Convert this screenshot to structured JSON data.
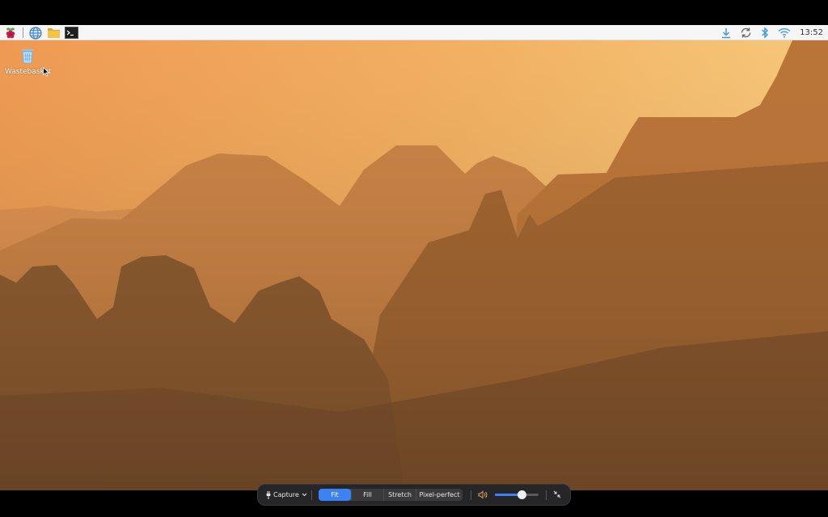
{
  "taskbar": {
    "launchers": [
      {
        "name": "raspberry-menu-icon"
      },
      {
        "name": "web-browser-icon"
      },
      {
        "name": "file-manager-icon"
      },
      {
        "name": "terminal-icon"
      }
    ],
    "tray": [
      {
        "name": "download-icon"
      },
      {
        "name": "updates-icon"
      },
      {
        "name": "bluetooth-icon"
      },
      {
        "name": "wifi-icon"
      }
    ],
    "clock": "13:52",
    "tray_color": "#3a9ad9"
  },
  "desktop": {
    "icons": [
      {
        "label": "Wastebasket",
        "icon": "trash-icon"
      }
    ]
  },
  "viewer": {
    "capture_label": "Capture",
    "scale_modes": [
      "Fit",
      "Fill",
      "Stretch",
      "Pixel-perfect"
    ],
    "active_mode": "Fit",
    "volume": 0.62,
    "accent": "#3b82f6"
  }
}
